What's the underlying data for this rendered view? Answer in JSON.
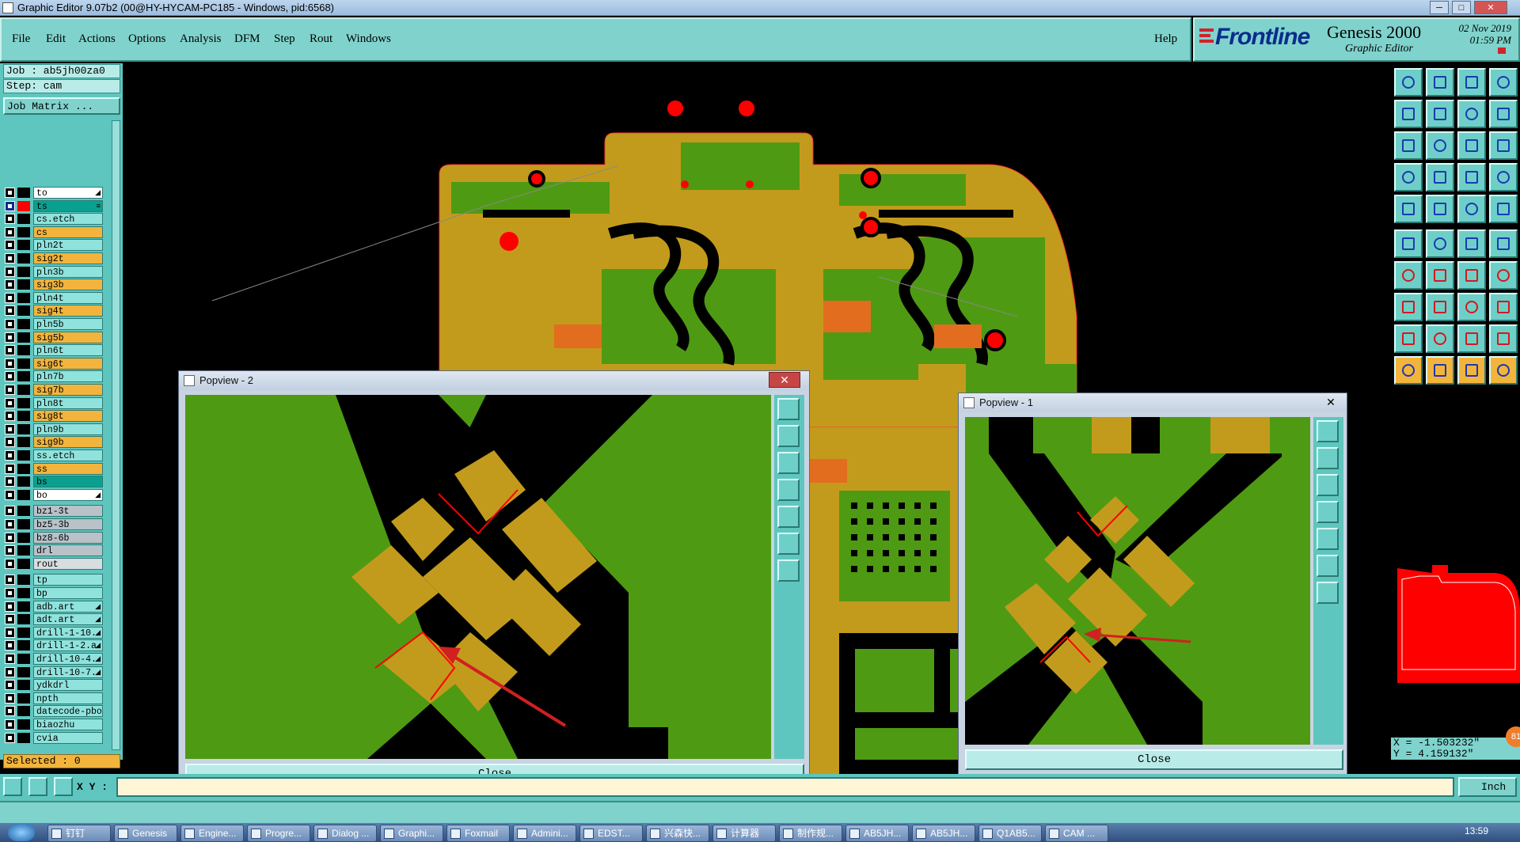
{
  "window": {
    "title": "Graphic Editor 9.07b2 (00@HY-HYCAM-PC185 - Windows, pid:6568)",
    "controls": [
      "─",
      "□",
      "✕"
    ]
  },
  "menu": {
    "items": [
      "File",
      "Edit",
      "Actions",
      "Options",
      "Analysis",
      "DFM",
      "Step",
      "Rout",
      "Windows"
    ],
    "help": "Help"
  },
  "brand": {
    "logo": "Frontline",
    "product": "Genesis 2000",
    "subtitle": "Graphic Editor",
    "date": "02 Nov 2019",
    "time": "01:59 PM"
  },
  "job": {
    "job_label": "Job : ab5jh00za0",
    "step_label": "Step: cam",
    "matrix_button": "Job Matrix ..."
  },
  "layers": [
    {
      "name": "to",
      "color": "#ffffff",
      "swatch": "#000000",
      "work": false,
      "mark": "◢"
    },
    {
      "name": "ts",
      "color": "#0aa08f",
      "swatch": "#ff0000",
      "work": true,
      "mark": "≡"
    },
    {
      "name": "cs.etch",
      "color": "#8fe3dc",
      "swatch": "#000000",
      "work": false,
      "mark": ""
    },
    {
      "name": "cs",
      "color": "#f2b43c",
      "swatch": "#000000",
      "work": false,
      "mark": ""
    },
    {
      "name": "pln2t",
      "color": "#8fe3dc",
      "swatch": "#000000",
      "work": false,
      "mark": ""
    },
    {
      "name": "sig2t",
      "color": "#f2b43c",
      "swatch": "#000000",
      "work": false,
      "mark": ""
    },
    {
      "name": "pln3b",
      "color": "#8fe3dc",
      "swatch": "#000000",
      "work": false,
      "mark": ""
    },
    {
      "name": "sig3b",
      "color": "#f2b43c",
      "swatch": "#000000",
      "work": false,
      "mark": ""
    },
    {
      "name": "pln4t",
      "color": "#8fe3dc",
      "swatch": "#000000",
      "work": false,
      "mark": ""
    },
    {
      "name": "sig4t",
      "color": "#f2b43c",
      "swatch": "#000000",
      "work": false,
      "mark": ""
    },
    {
      "name": "pln5b",
      "color": "#8fe3dc",
      "swatch": "#000000",
      "work": false,
      "mark": ""
    },
    {
      "name": "sig5b",
      "color": "#f2b43c",
      "swatch": "#000000",
      "work": false,
      "mark": ""
    },
    {
      "name": "pln6t",
      "color": "#8fe3dc",
      "swatch": "#000000",
      "work": false,
      "mark": ""
    },
    {
      "name": "sig6t",
      "color": "#f2b43c",
      "swatch": "#000000",
      "work": false,
      "mark": ""
    },
    {
      "name": "pln7b",
      "color": "#8fe3dc",
      "swatch": "#000000",
      "work": false,
      "mark": ""
    },
    {
      "name": "sig7b",
      "color": "#f2b43c",
      "swatch": "#000000",
      "work": false,
      "mark": ""
    },
    {
      "name": "pln8t",
      "color": "#8fe3dc",
      "swatch": "#000000",
      "work": false,
      "mark": ""
    },
    {
      "name": "sig8t",
      "color": "#f2b43c",
      "swatch": "#000000",
      "work": false,
      "mark": ""
    },
    {
      "name": "pln9b",
      "color": "#8fe3dc",
      "swatch": "#000000",
      "work": false,
      "mark": ""
    },
    {
      "name": "sig9b",
      "color": "#f2b43c",
      "swatch": "#000000",
      "work": false,
      "mark": ""
    },
    {
      "name": "ss.etch",
      "color": "#8fe3dc",
      "swatch": "#000000",
      "work": false,
      "mark": ""
    },
    {
      "name": "ss",
      "color": "#f2b43c",
      "swatch": "#000000",
      "work": false,
      "mark": ""
    },
    {
      "name": "bs",
      "color": "#0aa08f",
      "swatch": "#000000",
      "work": false,
      "mark": ""
    },
    {
      "name": "bo",
      "color": "#ffffff",
      "swatch": "#000000",
      "work": false,
      "mark": "◢"
    },
    {
      "name": "bz1-3t",
      "color": "#b8c2c8",
      "swatch": "#000000",
      "work": false,
      "mark": ""
    },
    {
      "name": "bz5-3b",
      "color": "#b8c2c8",
      "swatch": "#000000",
      "work": false,
      "mark": ""
    },
    {
      "name": "bz8-6b",
      "color": "#b8c2c8",
      "swatch": "#000000",
      "work": false,
      "mark": ""
    },
    {
      "name": "drl",
      "color": "#b8c2c8",
      "swatch": "#000000",
      "work": false,
      "mark": ""
    },
    {
      "name": "rout",
      "color": "#d8dde0",
      "swatch": "#000000",
      "work": false,
      "mark": ""
    },
    {
      "name": "tp",
      "color": "#8fe3dc",
      "swatch": "#000000",
      "work": false,
      "mark": ""
    },
    {
      "name": "bp",
      "color": "#8fe3dc",
      "swatch": "#000000",
      "work": false,
      "mark": ""
    },
    {
      "name": "adb.art",
      "color": "#8fe3dc",
      "swatch": "#000000",
      "work": false,
      "mark": "◢"
    },
    {
      "name": "adt.art",
      "color": "#8fe3dc",
      "swatch": "#000000",
      "work": false,
      "mark": "◢"
    },
    {
      "name": "drill-1-10.",
      "color": "#8fe3dc",
      "swatch": "#000000",
      "work": false,
      "mark": "◢"
    },
    {
      "name": "drill-1-2.a",
      "color": "#8fe3dc",
      "swatch": "#000000",
      "work": false,
      "mark": "◢"
    },
    {
      "name": "drill-10-4.",
      "color": "#8fe3dc",
      "swatch": "#000000",
      "work": false,
      "mark": "◢"
    },
    {
      "name": "drill-10-7.",
      "color": "#8fe3dc",
      "swatch": "#000000",
      "work": false,
      "mark": "◢"
    },
    {
      "name": "ydkdrl",
      "color": "#8fe3dc",
      "swatch": "#000000",
      "work": false,
      "mark": ""
    },
    {
      "name": "npth",
      "color": "#8fe3dc",
      "swatch": "#000000",
      "work": false,
      "mark": ""
    },
    {
      "name": "datecode-pbo",
      "color": "#8fe3dc",
      "swatch": "#000000",
      "work": false,
      "mark": ""
    },
    {
      "name": "biaozhu",
      "color": "#8fe3dc",
      "swatch": "#000000",
      "work": false,
      "mark": ""
    },
    {
      "name": "cvia",
      "color": "#8fe3dc",
      "swatch": "#000000",
      "work": false,
      "mark": ""
    }
  ],
  "selected": "Selected : 0",
  "xy": {
    "label": "X Y :",
    "value": "",
    "x_readout": "X = -1.503232\"",
    "y_readout": "Y =  4.159132\"",
    "units": "Inch"
  },
  "popviews": [
    {
      "title": "Popview - 2",
      "close": "Close"
    },
    {
      "title": "Popview - 1",
      "close": "Close"
    }
  ],
  "badge": "81",
  "taskbar": {
    "items": [
      "钉钉",
      "Genesis",
      "Engine...",
      "Progre...",
      "Dialog ...",
      "Graphi...",
      "Foxmail",
      "Admini...",
      "EDST...",
      "兴森快...",
      "计算器",
      "制作规...",
      "AB5JH...",
      "AB5JH...",
      "Q1AB5...",
      "CAM ..."
    ],
    "clock": "13:59"
  },
  "colors": {
    "board_copper": "#c39b1c",
    "board_green": "#4f9a13",
    "panel_teal": "#5fc6bf",
    "menu_teal": "#7fd3cc",
    "highlight_red": "#ff0000"
  }
}
